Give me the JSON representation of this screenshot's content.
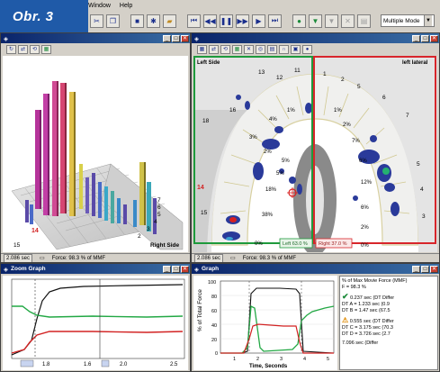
{
  "badge": "Obr. 3",
  "menu": {
    "items": [
      "Window",
      "Help"
    ]
  },
  "toolbar": {
    "mode_select": "Multiple Mode",
    "buttons": [
      "cut-icon",
      "copy-icon",
      "stop-icon",
      "settings-icon",
      "open-folder-icon",
      "rewind-icon",
      "step-back-icon",
      "pause-icon",
      "step-forward-icon",
      "play-icon",
      "fast-forward-icon",
      "record-green-icon",
      "tool-green-icon",
      "tool-grey-icon",
      "tool-grey2-icon",
      "print-icon"
    ]
  },
  "win3d": {
    "status_time": "2.086 sec",
    "status_force": "Force: 98.3 % of MMF",
    "labels": {
      "right_side": "Right Side",
      "n14": "14",
      "n15": "15",
      "n7": "7",
      "n6": "6",
      "n5": "5",
      "n4": "4",
      "n3": "3",
      "n2": "2"
    }
  },
  "occlusion": {
    "left_side": "Left Side",
    "left_lateral": "left lateral",
    "left_pct": "Left 63.0 %",
    "right_pct": "Right 37.0 %",
    "status_time": "2.086 sec",
    "status_force": "Force: 98.3 % of MMF",
    "teeth_left": [
      "18",
      "16",
      "13",
      "12",
      "11",
      "14",
      "15"
    ],
    "teeth_right": [
      "1",
      "2",
      "5",
      "6",
      "7",
      "5",
      "4",
      "3"
    ],
    "pct_left": [
      "4%",
      "1%",
      "3%",
      "2%",
      "5%",
      "5%",
      "18%",
      "38%",
      "0%",
      "0%"
    ],
    "pct_right": [
      "1%",
      "2%",
      "7%",
      "6%",
      "12%",
      "6%",
      "2%",
      "0%"
    ]
  },
  "zoom": {
    "title": "Zoom Graph",
    "x_ticks": [
      "1.8",
      "1.6",
      "2.0",
      "2.5"
    ]
  },
  "graph": {
    "title": "Graph",
    "y_label": "% of Total Force",
    "x_label": "Time, Seconds",
    "y_ticks": [
      "100",
      "80",
      "60",
      "40",
      "20",
      "0"
    ],
    "x_ticks": [
      "1",
      "2",
      "3",
      "4",
      "5"
    ],
    "legend": {
      "header": "% of Max Movie Force (MMF)",
      "f_line": "F = 98.3 %",
      "sec1": [
        "0.237 sec (DT Differ",
        "DT A = 1.233 sec (0.9",
        "DT B = 1.47 sec (67.5"
      ],
      "sec2": [
        "0.555 sec (DT Differ",
        "DT C = 3.175 sec (70.3",
        "DT D = 3.726 sec (2.7"
      ],
      "footer": "7.096 sec (Differ"
    }
  },
  "colors": {
    "title_active": "#0a246a",
    "left_border": "#1e9a3c",
    "right_border": "#d8262b",
    "force_black": "#111111",
    "force_green": "#22a844",
    "force_red": "#d22222"
  }
}
